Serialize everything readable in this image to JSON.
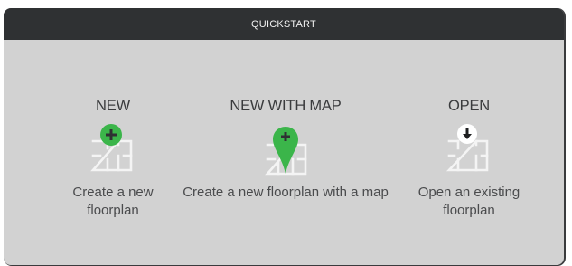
{
  "header": {
    "title": "QUICKSTART"
  },
  "options": [
    {
      "title": "NEW",
      "description": "Create a new floorplan",
      "icon": "floorplan-plus-icon"
    },
    {
      "title": "NEW WITH MAP",
      "description": "Create a new floorplan with a map",
      "icon": "floorplan-map-pin-icon"
    },
    {
      "title": "OPEN",
      "description": "Open an existing floorplan",
      "icon": "floorplan-download-icon"
    }
  ],
  "colors": {
    "header_bg": "#2f3133",
    "panel_bg": "#d2d2d2",
    "accent_green": "#3bb54a",
    "icon_outline": "#f4f4f4"
  }
}
